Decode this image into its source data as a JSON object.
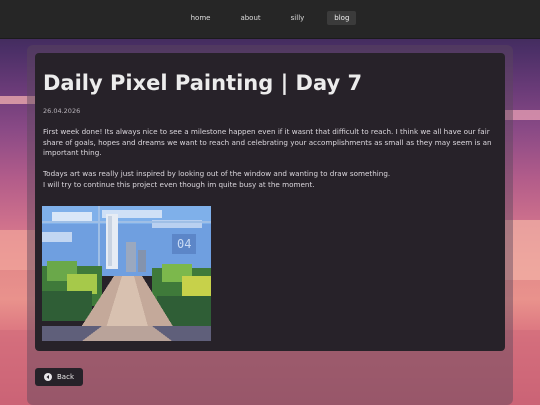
{
  "nav": {
    "items": [
      {
        "label": "home",
        "active": false
      },
      {
        "label": "about",
        "active": false
      },
      {
        "label": "silly",
        "active": false
      },
      {
        "label": "blog",
        "active": true
      }
    ]
  },
  "post": {
    "title": "Daily Pixel Painting | Day 7",
    "date": "26.04.2026",
    "paragraph_1": "First week done! Its always nice to see a milestone happen even if it wasnt that difficult to reach. I think we all have our fair share of goals, hopes and dreams we want to reach and celebrating your accomplishments as small as they may seem is an important thing.",
    "paragraph_2_line_1": "Todays art was really just inspired by looking out of the window and wanting to draw something.",
    "paragraph_2_line_2": "I will try to continue this project even though im quite busy at the moment.",
    "artwork_text": "04"
  },
  "back": {
    "label": "Back",
    "icon": "arrow-left-circle-icon"
  }
}
